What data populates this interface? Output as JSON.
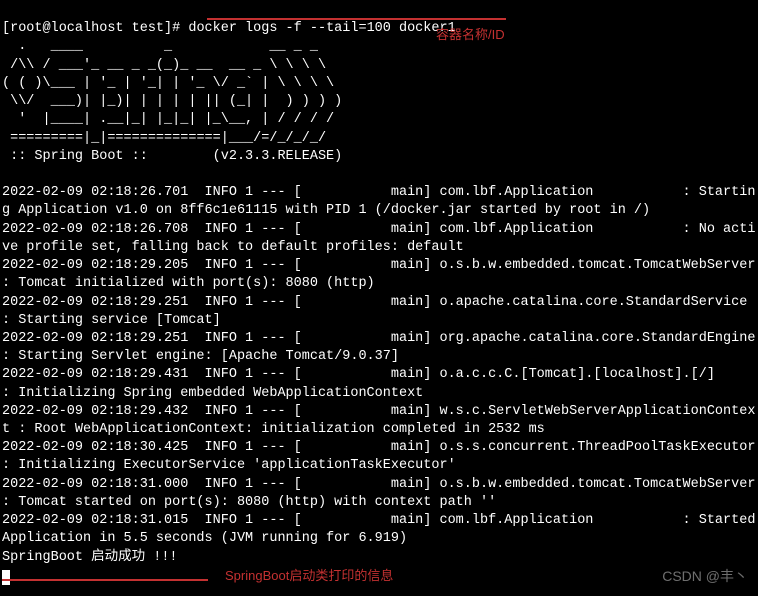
{
  "prompt": {
    "user": "[root@localhost test]# ",
    "command": "docker logs -f --tail=100 docker1"
  },
  "annotations": {
    "container_label": "容器名称/ID",
    "springboot_label": "SpringBoot启动类打印的信息"
  },
  "watermark": "CSDN @丰丶",
  "ascii_art": [
    "  .   ____          _            __ _ _",
    " /\\\\ / ___'_ __ _ _(_)_ __  __ _ \\ \\ \\ \\",
    "( ( )\\___ | '_ | '_| | '_ \\/ _` | \\ \\ \\ \\",
    " \\\\/  ___)| |_)| | | | | || (_| |  ) ) ) )",
    "  '  |____| .__|_| |_|_| |_\\__, | / / / /",
    " =========|_|==============|___/=/_/_/_/",
    " :: Spring Boot ::        (v2.3.3.RELEASE)"
  ],
  "logs": [
    "2022-02-09 02:18:26.701  INFO 1 --- [           main] com.lbf.Application           : Starting Application v1.0 on 8ff6c1e61115 with PID 1 (/docker.jar started by root in /)",
    "2022-02-09 02:18:26.708  INFO 1 --- [           main] com.lbf.Application           : No active profile set, falling back to default profiles: default",
    "2022-02-09 02:18:29.205  INFO 1 --- [           main] o.s.b.w.embedded.tomcat.TomcatWebServer  : Tomcat initialized with port(s): 8080 (http)",
    "2022-02-09 02:18:29.251  INFO 1 --- [           main] o.apache.catalina.core.StandardService   : Starting service [Tomcat]",
    "2022-02-09 02:18:29.251  INFO 1 --- [           main] org.apache.catalina.core.StandardEngine  : Starting Servlet engine: [Apache Tomcat/9.0.37]",
    "2022-02-09 02:18:29.431  INFO 1 --- [           main] o.a.c.c.C.[Tomcat].[localhost].[/]       : Initializing Spring embedded WebApplicationContext",
    "2022-02-09 02:18:29.432  INFO 1 --- [           main] w.s.c.ServletWebServerApplicationContext : Root WebApplicationContext: initialization completed in 2532 ms",
    "2022-02-09 02:18:30.425  INFO 1 --- [           main] o.s.s.concurrent.ThreadPoolTaskExecutor  : Initializing ExecutorService 'applicationTaskExecutor'",
    "2022-02-09 02:18:31.000  INFO 1 --- [           main] o.s.b.w.embedded.tomcat.TomcatWebServer  : Tomcat started on port(s): 8080 (http) with context path ''",
    "2022-02-09 02:18:31.015  INFO 1 --- [           main] com.lbf.Application           : Started Application in 5.5 seconds (JVM running for 6.919)"
  ],
  "success_line": "SpringBoot 启动成功 !!!"
}
